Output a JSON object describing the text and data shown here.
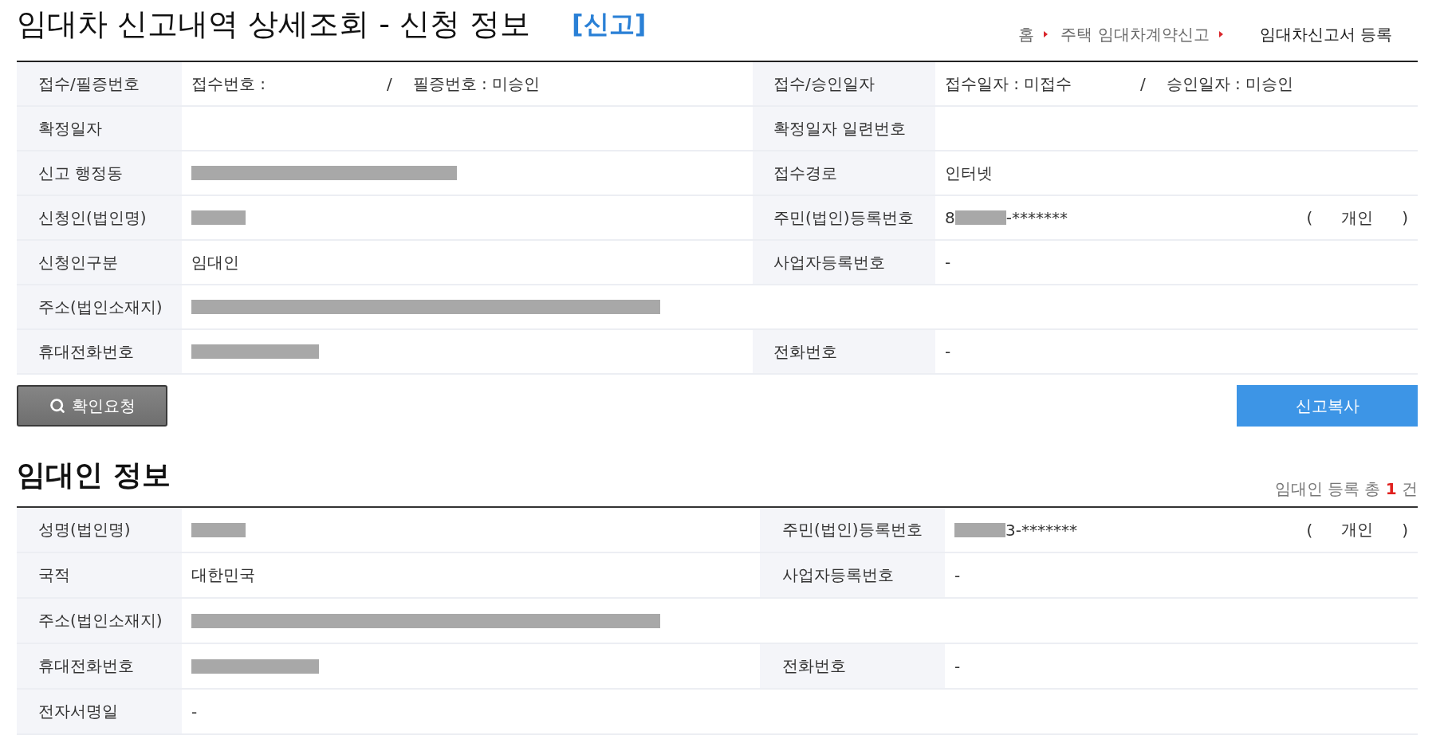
{
  "header": {
    "title": "임대차 신고내역 상세조회 - 신청 정보",
    "tag": "[신고]",
    "breadcrumb": [
      {
        "label": "홈",
        "selected": false
      },
      {
        "label": "주택 임대차계약신고",
        "selected": false
      },
      {
        "label": "임대차신고서 등록",
        "selected": true
      }
    ]
  },
  "application": {
    "rows": [
      {
        "fields": [
          {
            "label": "접수/필증번호",
            "value": [
              {
                "kind": "text",
                "text": "접수번호 :"
              },
              {
                "kind": "divider",
                "text": "/"
              },
              {
                "kind": "text",
                "text": "필증번호 : 미승인"
              }
            ]
          },
          {
            "label": "접수/승인일자",
            "value": [
              {
                "kind": "text",
                "text": "접수일자 : 미접수"
              },
              {
                "kind": "divider",
                "text": "/"
              },
              {
                "kind": "text",
                "text": "승인일자 : 미승인"
              }
            ]
          }
        ]
      },
      {
        "fields": [
          {
            "label": "확정일자"
          },
          {
            "label": "확정일자 일련번호"
          }
        ]
      },
      {
        "fields": [
          {
            "label": "신고 행정동",
            "value": [
              {
                "kind": "redacted-district"
              }
            ]
          },
          {
            "label": "접수경로",
            "value": [
              {
                "kind": "text",
                "text": "인터넷"
              }
            ]
          }
        ]
      },
      {
        "fields": [
          {
            "label": "신청인(법인명)",
            "value": [
              {
                "kind": "redacted-name"
              }
            ]
          },
          {
            "label": "주민(법인)등록번호",
            "value": [
              {
                "kind": "text",
                "text": "8"
              },
              {
                "kind": "redacted-number"
              },
              {
                "kind": "text",
                "text": "-*******"
              }
            ],
            "person_type": [
              "(",
              "개인",
              ")"
            ]
          }
        ]
      },
      {
        "fields": [
          {
            "label": "신청인구분",
            "value": [
              {
                "kind": "text",
                "text": "임대인"
              }
            ]
          },
          {
            "label": "사업자등록번호",
            "value": [
              {
                "kind": "text",
                "text": "-"
              }
            ]
          }
        ]
      },
      {
        "fields": [
          {
            "label": "주소(법인소재지)",
            "value": [
              {
                "kind": "redacted-address"
              }
            ]
          }
        ]
      },
      {
        "fields": [
          {
            "label": "휴대전화번호",
            "value": [
              {
                "kind": "redacted-phone"
              }
            ]
          },
          {
            "label": "전화번호",
            "value": [
              {
                "kind": "text",
                "text": "-"
              }
            ]
          }
        ]
      }
    ]
  },
  "actions": [
    {
      "label": "확인요청",
      "kind": "search"
    },
    {
      "label": "신고복사",
      "kind": "primary"
    }
  ],
  "lessor": {
    "title": "임대인 정보",
    "count": "임대인 등록 총 **1** 건",
    "rows": [
      {
        "fields": [
          {
            "label": "성명(법인명)",
            "value": [
              {
                "kind": "redacted-name"
              }
            ]
          },
          {
            "label": "주민(법인)등록번호",
            "value": [
              {
                "kind": "redacted-number"
              },
              {
                "kind": "text",
                "text": "3-*******"
              }
            ],
            "person_type": [
              "(",
              "개인",
              ")"
            ]
          }
        ]
      },
      {
        "fields": [
          {
            "label": "국적",
            "value": [
              {
                "kind": "text",
                "text": "대한민국"
              }
            ]
          },
          {
            "label": "사업자등록번호",
            "value": [
              {
                "kind": "text",
                "text": "-"
              }
            ]
          }
        ]
      },
      {
        "fields": [
          {
            "label": "주소(법인소재지)",
            "value": [
              {
                "kind": "redacted-address"
              }
            ]
          }
        ]
      },
      {
        "fields": [
          {
            "label": "휴대전화번호",
            "value": [
              {
                "kind": "redacted-phone"
              }
            ]
          },
          {
            "label": "전화번호",
            "value": [
              {
                "kind": "text",
                "text": "-"
              }
            ]
          }
        ]
      },
      {
        "fields": [
          {
            "label": "전자서명일",
            "value": [
              {
                "kind": "text",
                "text": "-"
              }
            ]
          }
        ]
      }
    ]
  }
}
